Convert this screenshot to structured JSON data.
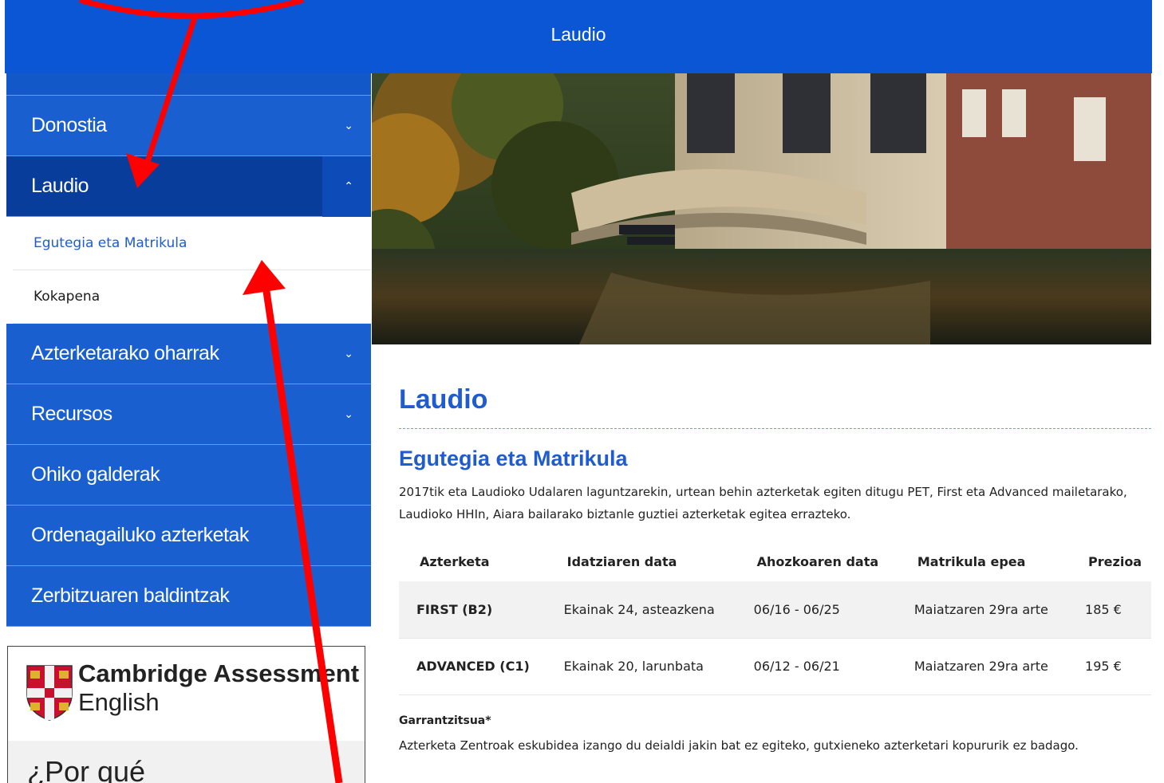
{
  "header": {
    "title": "Laudio"
  },
  "sidebar": {
    "items": [
      {
        "label": "Donostia",
        "chevron": "chevron-down-icon"
      },
      {
        "label": "Laudio",
        "chevron": "chevron-up-icon",
        "active": true,
        "subitems": [
          {
            "label": "Egutegia eta Matrikula",
            "current": true
          },
          {
            "label": "Kokapena"
          }
        ]
      },
      {
        "label": "Azterketarako oharrak",
        "chevron": "chevron-down-icon"
      },
      {
        "label": "Recursos",
        "chevron": "chevron-down-icon"
      },
      {
        "label": "Ohiko galderak"
      },
      {
        "label": "Ordenagailuko azterketak"
      },
      {
        "label": "Zerbitzuaren baldintzak"
      }
    ]
  },
  "promo": {
    "brand_line1": "Cambridge Assessment",
    "brand_line2": "English",
    "heading": "¿Por qué"
  },
  "main": {
    "title": "Laudio",
    "section_title": "Egutegia eta Matrikula",
    "intro": "2017tik eta Laudioko Udalaren laguntzarekin, urtean behin azterketak egiten ditugu PET, First eta Advanced mailetarako, Laudioko HHIn, Aiara bailarako biztanle guztiei azterketak egitea errazteko.",
    "table": {
      "headers": [
        "Azterketa",
        "Idatziaren data",
        "Ahozkoaren data",
        "Matrikula epea",
        "Prezioa"
      ],
      "rows": [
        [
          "FIRST (B2)",
          "Ekainak 24, asteazkena",
          "06/16 - 06/25",
          "Maiatzaren 29ra arte",
          "185 €"
        ],
        [
          "ADVANCED (C1)",
          "Ekainak 20, larunbata",
          "06/12 - 06/21",
          "Maiatzaren 29ra arte",
          "195 €"
        ]
      ]
    },
    "note_title": "Garrantzitsua*",
    "note": "Azterketa Zentroak eskubidea izango du deialdi jakin bat ez egiteko, gutxieneko azterketari kopururik ez badago."
  },
  "colors": {
    "header_blue": "#0b56d4",
    "nav_blue": "#1a5fd0",
    "nav_active": "#083d9c",
    "link_blue": "#1f5cd0",
    "annotation_red": "#ff0000"
  }
}
